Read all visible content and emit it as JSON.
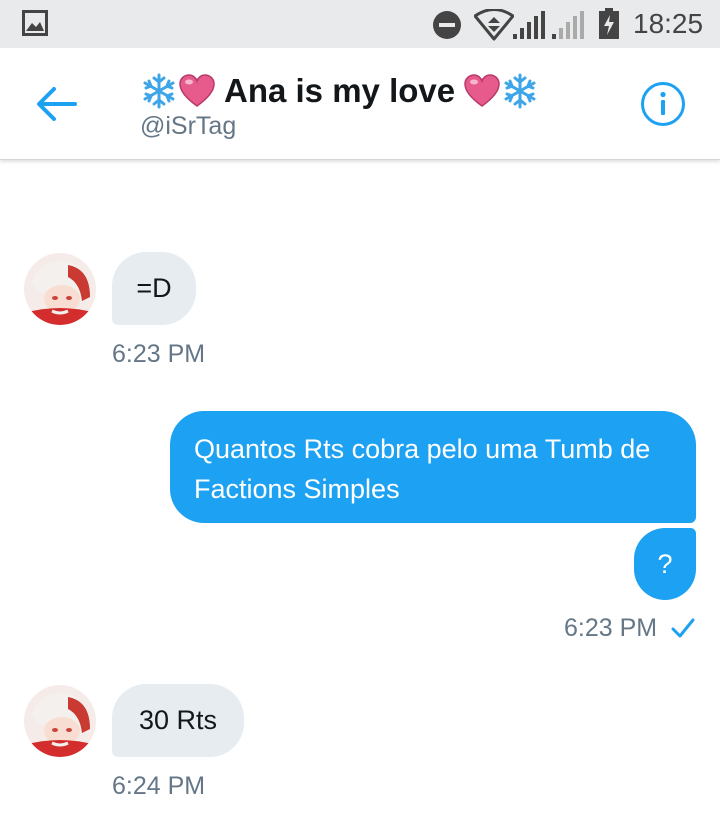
{
  "status_bar": {
    "time": "18:25",
    "icons": [
      "gallery-icon",
      "do-not-disturb-icon",
      "wifi-icon",
      "signal-icon",
      "signal-icon",
      "battery-charging-icon"
    ]
  },
  "header": {
    "title": "Ana is my love",
    "handle": "@iSrTag",
    "back_icon": "arrow-left-icon",
    "info_icon": "info-icon",
    "title_emoji": [
      "snowflake",
      "heart",
      "heart",
      "snowflake"
    ]
  },
  "colors": {
    "accent": "#1da1f2",
    "incoming_bubble": "#e6ecf0",
    "secondary_text": "#657786",
    "heart": "#e75a8c",
    "snowflake": "#3da5e8"
  },
  "messages": [
    {
      "direction": "incoming",
      "text": "=D",
      "time": "6:23 PM"
    },
    {
      "direction": "outgoing",
      "text": "Quantos Rts cobra pelo uma Tumb de Factions Simples"
    },
    {
      "direction": "outgoing",
      "text": "?",
      "time": "6:23 PM",
      "read": true
    },
    {
      "direction": "incoming",
      "text": "30 Rts",
      "time": "6:24 PM"
    }
  ]
}
